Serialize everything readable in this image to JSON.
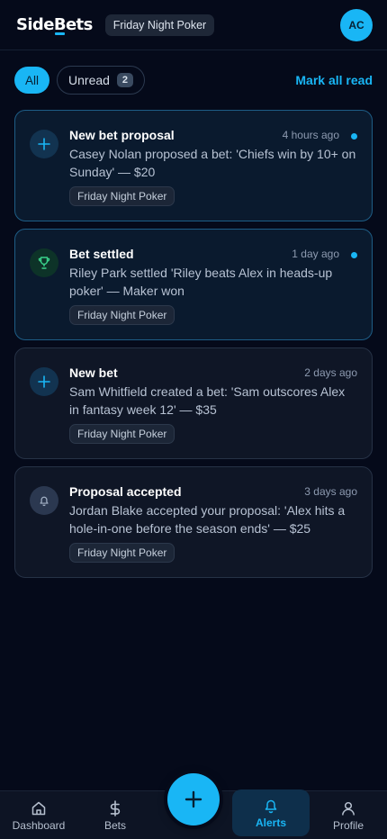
{
  "header": {
    "logo_prefix": "Side",
    "logo_accent": "B",
    "logo_suffix": "ets",
    "group_name": "Friday Night Poker",
    "avatar_initials": "AC"
  },
  "filters": {
    "all_label": "All",
    "unread_label": "Unread",
    "unread_count": "2",
    "mark_all_read": "Mark all read"
  },
  "notifications": [
    {
      "icon": "plus-icon",
      "title": "New bet proposal",
      "time": "4 hours ago",
      "body": "Casey Nolan proposed a bet: 'Chiefs win by 10+ on Sunday' — $20",
      "group": "Friday Night Poker",
      "unread": true
    },
    {
      "icon": "trophy-icon",
      "title": "Bet settled",
      "time": "1 day ago",
      "body": "Riley Park settled 'Riley beats Alex in heads-up poker' — Maker won",
      "group": "Friday Night Poker",
      "unread": true
    },
    {
      "icon": "plus-icon",
      "title": "New bet",
      "time": "2 days ago",
      "body": "Sam Whitfield created a bet: 'Sam outscores Alex in fantasy week 12' — $35",
      "group": "Friday Night Poker",
      "unread": false
    },
    {
      "icon": "bell-icon",
      "title": "Proposal accepted",
      "time": "3 days ago",
      "body": "Jordan Blake accepted your proposal: 'Alex hits a hole-in-one before the season ends' — $25",
      "group": "Friday Night Poker",
      "unread": false
    }
  ],
  "nav": {
    "dashboard": "Dashboard",
    "bets": "Bets",
    "fab_icon": "plus-icon",
    "alerts": "Alerts",
    "profile": "Profile"
  },
  "colors": {
    "accent": "#19b6f5",
    "background": "#050a1a"
  }
}
